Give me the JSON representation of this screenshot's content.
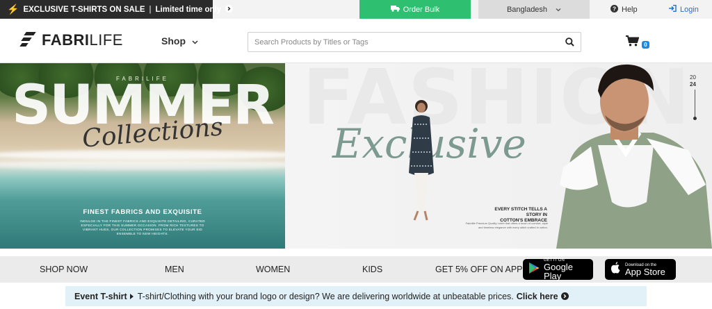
{
  "topbar": {
    "promo_text": "EXCLUSIVE T-SHIRTS ON SALE",
    "promo_sep": "|",
    "promo_cta": "Limited time only",
    "order_bulk": "Order Bulk",
    "country": "Bangladesh",
    "help": "Help",
    "login": "Login"
  },
  "header": {
    "logo_bold": "FABRI",
    "logo_light": "LIFE",
    "shop": "Shop",
    "search_placeholder": "Search Products by Titles or Tags",
    "cart_count": "0"
  },
  "hero": {
    "left": {
      "brand": "FABRILIFE",
      "headline": "SUMMER",
      "script": "Collections",
      "subhead": "FINEST FABRICS AND EXQUISITE",
      "body": "INDULGE IN THE FINEST FABRICS AND EXQUISITE DETAILING, CURATED ESPECIALLY FOR THIS SUMMER OCCASION. FROM RICH TEXTURES TO VIBRANT HUES, OUR COLLECTION PROMISES TO ELEVATE YOUR EID ENSEMBLE TO NEW HEIGHTS."
    },
    "right": {
      "bg_word": "FASHION",
      "script": "Exclusive",
      "year_top": "20",
      "year_bottom": "24",
      "tagline_1": "EVERY STITCH TELLS A STORY IN",
      "tagline_2": "COTTON'S EMBRACE",
      "small_copy": "Fabrilife Premium Quality t-shirt that offers a touch of comfort, style and timeless elegance with every stitch crafted in cotton."
    }
  },
  "nav": {
    "items": [
      "SHOP NOW",
      "MEN",
      "WOMEN",
      "KIDS"
    ],
    "app_offer": "GET 5% OFF ON APP",
    "google_small": "GET IT ON",
    "google_big": "Google Play",
    "apple_small": "Download on the",
    "apple_big": "App Store"
  },
  "event": {
    "label": "Event T-shirt",
    "text": "T-shirt/Clothing with your brand logo or design? We are delivering worldwide at unbeatable prices.",
    "cta": "Click here"
  },
  "colors": {
    "accent_green": "#2fbf71",
    "link_blue": "#1e6fd6",
    "event_bg": "#e2f1f7"
  }
}
